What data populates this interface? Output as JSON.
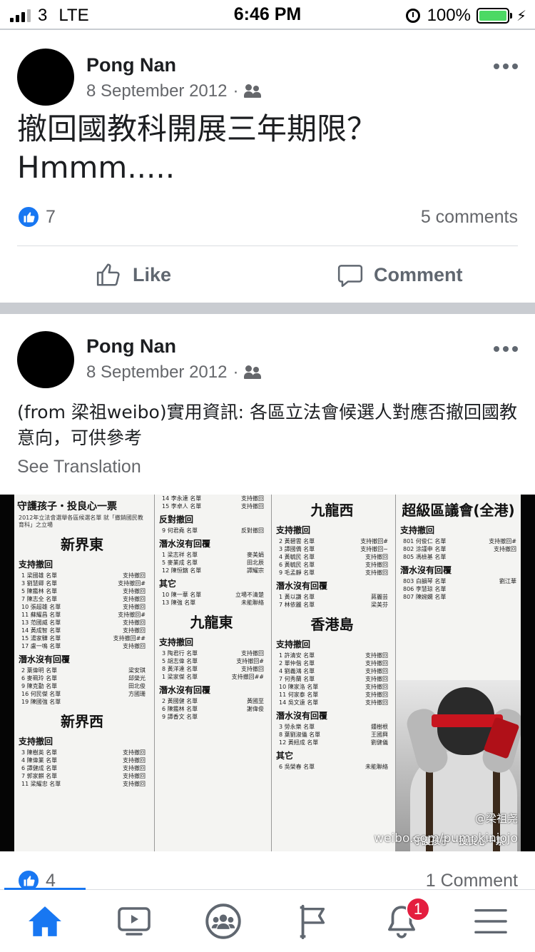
{
  "status_bar": {
    "carrier": "3",
    "network": "LTE",
    "time": "6:46 PM",
    "battery_percent": "100%",
    "battery_level": 1.0,
    "charging": true
  },
  "posts": [
    {
      "author": "Pong Nan",
      "date": "8 September 2012",
      "audience_icon": "friends-icon",
      "text": "撤回國教科開展三年期限？ Hmmm.....",
      "reaction_count": "7",
      "comments_label": "5 comments",
      "like_label": "Like",
      "comment_label": "Comment"
    },
    {
      "author": "Pong Nan",
      "date": "8 September 2012",
      "audience_icon": "friends-icon",
      "text": "(from 梁祖weibo)實用資訊: 各區立法會候選人對應否撤回國教意向，可供參考",
      "see_translation": "See Translation",
      "reaction_count": "4",
      "comments_label": "1 Comment"
    }
  ],
  "poster": {
    "title": "守護孩子・投良心一票",
    "subtitle": "2012年立法會選舉各區候選名單 就「撤銷國民教育科」之立場",
    "watermark_handle": "@梁祖尧",
    "watermark_url": "weibo.com/pumpkinjojo",
    "bottom_slogan": "守護孩子・投良心一票",
    "columns": [
      {
        "sections": [
          {
            "district": "新界東"
          },
          {
            "heading": "支持撤回",
            "rows": [
              {
                "num": "1",
                "name": "梁國雄",
                "role": "名單",
                "stance": "支持撤回"
              },
              {
                "num": "3",
                "name": "劉慧卿",
                "role": "名單",
                "stance": "支持撤回#"
              },
              {
                "num": "5",
                "name": "陳鑑林",
                "role": "名單",
                "stance": "支持撤回"
              },
              {
                "num": "7",
                "name": "陳志全",
                "role": "名單",
                "stance": "支持撤回"
              },
              {
                "num": "10",
                "name": "張超雄",
                "role": "名單",
                "stance": "支持撤回"
              },
              {
                "num": "11",
                "name": "蘇耀昌",
                "role": "名單",
                "stance": "支持撤回#"
              },
              {
                "num": "13",
                "name": "范國威",
                "role": "名單",
                "stance": "支持撤回"
              },
              {
                "num": "14",
                "name": "黃成智",
                "role": "名單",
                "stance": "支持撤回"
              },
              {
                "num": "15",
                "name": "湯家驊",
                "role": "名單",
                "stance": "支持撤回##"
              },
              {
                "num": "17",
                "name": "盧一鳴",
                "role": "名單",
                "stance": "支持撤回"
              }
            ]
          },
          {
            "heading": "潛水沒有回覆",
            "rows": [
              {
                "num": "2",
                "name": "葉偉明",
                "role": "名單",
                "stance": "梁安琪"
              },
              {
                "num": "6",
                "name": "麥珮玲",
                "role": "名單",
                "stance": "邱榮光"
              },
              {
                "num": "9",
                "name": "陳克勤",
                "role": "名單",
                "stance": "田北俊"
              },
              {
                "num": "16",
                "name": "何民傑",
                "role": "名單",
                "stance": "方國珊"
              },
              {
                "num": "19",
                "name": "陳國強",
                "role": "名單",
                "stance": ""
              }
            ]
          },
          {
            "district": "新界西"
          },
          {
            "heading": "支持撤回",
            "rows": [
              {
                "num": "3",
                "name": "陳樹英",
                "role": "名單",
                "stance": "支持撤回"
              },
              {
                "num": "4",
                "name": "陳偉業",
                "role": "名單",
                "stance": "支持撤回"
              },
              {
                "num": "6",
                "name": "譚健成",
                "role": "名單",
                "stance": "支持撤回"
              },
              {
                "num": "7",
                "name": "郭家麒",
                "role": "名單",
                "stance": "支持撤回"
              },
              {
                "num": "11",
                "name": "梁耀忠",
                "role": "名單",
                "stance": "支持撤回"
              }
            ]
          }
        ]
      },
      {
        "sections": [
          {
            "heading": "",
            "rows": [
              {
                "num": "14",
                "name": "李永達",
                "role": "名單",
                "stance": "支持撤回"
              },
              {
                "num": "15",
                "name": "李卓人",
                "role": "名單",
                "stance": "支持撤回"
              }
            ]
          },
          {
            "heading": "反對撤回",
            "rows": [
              {
                "num": "9",
                "name": "何君堯",
                "role": "名單",
                "stance": "反對撤回"
              }
            ]
          },
          {
            "heading": "潛水沒有回覆",
            "rows": [
              {
                "num": "1",
                "name": "梁志祥",
                "role": "名單",
                "stance": "麥美娟"
              },
              {
                "num": "5",
                "name": "麥業成",
                "role": "名單",
                "stance": "田北辰"
              },
              {
                "num": "12",
                "name": "陳恒鑌",
                "role": "名單",
                "stance": "譚耀宗"
              }
            ]
          },
          {
            "heading": "其它",
            "rows": [
              {
                "num": "10",
                "name": "陳一華",
                "role": "名單",
                "stance": "立場不清楚"
              },
              {
                "num": "13",
                "name": "陳強",
                "role": "名單",
                "stance": "未能聯絡"
              }
            ]
          },
          {
            "district": "九龍東"
          },
          {
            "heading": "支持撤回",
            "rows": [
              {
                "num": "3",
                "name": "陶君行",
                "role": "名單",
                "stance": "支持撤回"
              },
              {
                "num": "5",
                "name": "胡志偉",
                "role": "名單",
                "stance": "支持撤回#"
              },
              {
                "num": "8",
                "name": "黃洋達",
                "role": "名單",
                "stance": "支持撤回"
              },
              {
                "num": "1",
                "name": "梁家傑",
                "role": "名單",
                "stance": "支持撤回##"
              }
            ]
          },
          {
            "heading": "潛水沒有回覆",
            "rows": [
              {
                "num": "2",
                "name": "黃國健",
                "role": "名單",
                "stance": "黃國至"
              },
              {
                "num": "6",
                "name": "陳鑑林",
                "role": "名單",
                "stance": "謝偉俊"
              },
              {
                "num": "9",
                "name": "譚香文",
                "role": "名單",
                "stance": ""
              }
            ]
          }
        ]
      },
      {
        "sections": [
          {
            "district": "九龍西"
          },
          {
            "heading": "支持撤回",
            "rows": [
              {
                "num": "2",
                "name": "黃碧雲",
                "role": "名單",
                "stance": "支持撤回#"
              },
              {
                "num": "3",
                "name": "譚國僑",
                "role": "名單",
                "stance": "支持撤回~"
              },
              {
                "num": "4",
                "name": "黃毓民",
                "role": "名單",
                "stance": "支持撤回"
              },
              {
                "num": "6",
                "name": "黃毓民",
                "role": "名單",
                "stance": "支持撤回"
              },
              {
                "num": "9",
                "name": "毛孟靜",
                "role": "名單",
                "stance": "支持撤回"
              }
            ]
          },
          {
            "heading": "潛水沒有回覆",
            "rows": [
              {
                "num": "1",
                "name": "黃以謙",
                "role": "名單",
                "stance": "蔣麗芸"
              },
              {
                "num": "7",
                "name": "林依麗",
                "role": "名單",
                "stance": "梁美芬"
              }
            ]
          },
          {
            "district": "香港島"
          },
          {
            "heading": "支持撤回",
            "rows": [
              {
                "num": "1",
                "name": "許清安",
                "role": "名單",
                "stance": "支持撤回"
              },
              {
                "num": "2",
                "name": "單仲偕",
                "role": "名單",
                "stance": "支持撤回"
              },
              {
                "num": "4",
                "name": "劉義鴻",
                "role": "名單",
                "stance": "支持撤回"
              },
              {
                "num": "7",
                "name": "何秀蘭",
                "role": "名單",
                "stance": "支持撤回"
              },
              {
                "num": "10",
                "name": "陳家洛",
                "role": "名單",
                "stance": "支持撤回"
              },
              {
                "num": "11",
                "name": "何家泰",
                "role": "名單",
                "stance": "支持撤回"
              },
              {
                "num": "14",
                "name": "吳文遠",
                "role": "名單",
                "stance": "支持撤回"
              }
            ]
          },
          {
            "heading": "潛水沒有回覆",
            "rows": [
              {
                "num": "3",
                "name": "勞永樂",
                "role": "名單",
                "stance": "鍾樹根"
              },
              {
                "num": "8",
                "name": "葉劉淑儀",
                "role": "名單",
                "stance": "王國興"
              },
              {
                "num": "12",
                "name": "黃紐成",
                "role": "名單",
                "stance": "劉健儀"
              }
            ]
          },
          {
            "heading": "其它",
            "rows": [
              {
                "num": "6",
                "name": "吳榮春",
                "role": "名單",
                "stance": "未能聯絡"
              }
            ]
          }
        ]
      },
      {
        "sections": [
          {
            "district": "超級區議會(全港)"
          },
          {
            "heading": "支持撤回",
            "rows": [
              {
                "num": "801",
                "name": "何俊仁",
                "role": "名單",
                "stance": "支持撤回#"
              },
              {
                "num": "802",
                "name": "涂謹申",
                "role": "名單",
                "stance": "支持撤回"
              },
              {
                "num": "805",
                "name": "馮檢基",
                "role": "名單",
                "stance": ""
              }
            ]
          },
          {
            "heading": "潛水沒有回覆",
            "rows": [
              {
                "num": "803",
                "name": "白韻琴",
                "role": "名單",
                "stance": "劉江華"
              },
              {
                "num": "806",
                "name": "李慧琼",
                "role": "名單",
                "stance": ""
              },
              {
                "num": "807",
                "name": "陳婉嫻",
                "role": "名單",
                "stance": ""
              }
            ]
          }
        ]
      }
    ]
  },
  "bottom_nav": {
    "items": [
      {
        "icon": "home-icon",
        "active": true
      },
      {
        "icon": "watch-icon",
        "active": false
      },
      {
        "icon": "groups-icon",
        "active": false
      },
      {
        "icon": "pages-flag-icon",
        "active": false
      },
      {
        "icon": "bell-icon",
        "active": false,
        "badge": "1"
      },
      {
        "icon": "menu-icon",
        "active": false
      }
    ]
  },
  "colors": {
    "brand_blue": "#1877f2",
    "text_secondary": "#65676b",
    "badge_red": "#e41e3f"
  }
}
